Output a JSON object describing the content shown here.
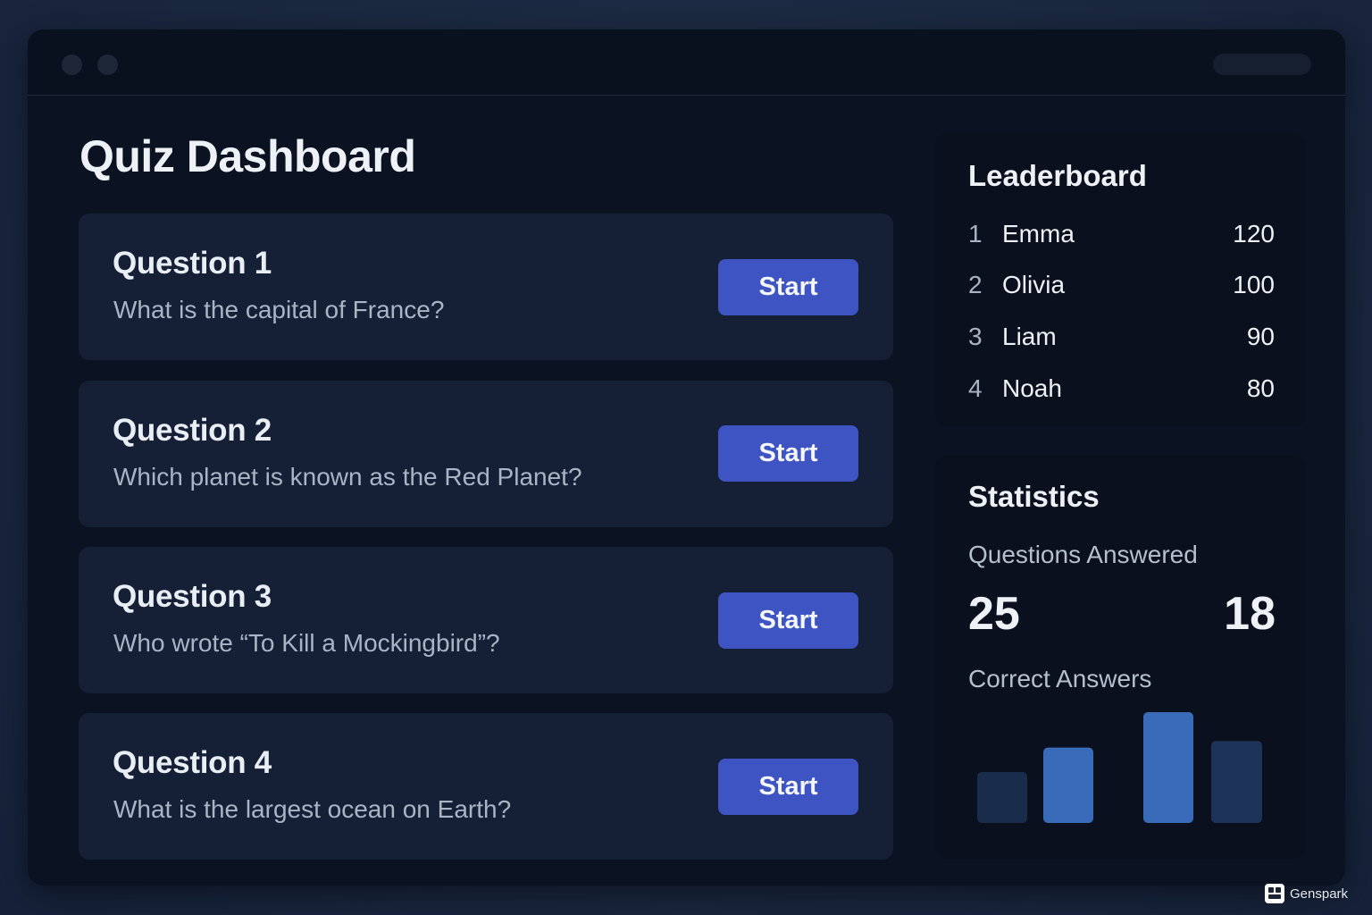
{
  "page": {
    "title": "Quiz Dashboard"
  },
  "questions": [
    {
      "title": "Question 1",
      "text": "What is the capital of France?",
      "button_label": "Start"
    },
    {
      "title": "Question 2",
      "text": "Which planet is known as the Red Planet?",
      "button_label": "Start"
    },
    {
      "title": "Question 3",
      "text": "Who wrote “To Kill a Mockingbird”?",
      "button_label": "Start"
    },
    {
      "title": "Question 4",
      "text": "What is the largest ocean on Earth?",
      "button_label": "Start"
    }
  ],
  "leaderboard": {
    "title": "Leaderboard",
    "entries": [
      {
        "rank": "1",
        "name": "Emma",
        "score": "120"
      },
      {
        "rank": "2",
        "name": "Olivia",
        "score": "100"
      },
      {
        "rank": "3",
        "name": "Liam",
        "score": "90"
      },
      {
        "rank": "4",
        "name": "Noah",
        "score": "80"
      }
    ]
  },
  "statistics": {
    "title": "Statistics",
    "questions_answered_label": "Questions Answered",
    "questions_answered_value": "25",
    "correct_answers_value": "18",
    "correct_answers_label": "Correct Answers"
  },
  "chart_data": {
    "type": "bar",
    "values": [
      0.46,
      0.68,
      1.0,
      0.74
    ],
    "colors": [
      "#1a2c4c",
      "#3a6bb8",
      "#3a6bb8",
      "#1d3358"
    ]
  },
  "watermark": {
    "text": "Genspark"
  },
  "colors": {
    "accent": "#3d54c2",
    "card_bg": "#152036",
    "window_bg": "#0b1323",
    "panel_bg": "#0a101d"
  }
}
